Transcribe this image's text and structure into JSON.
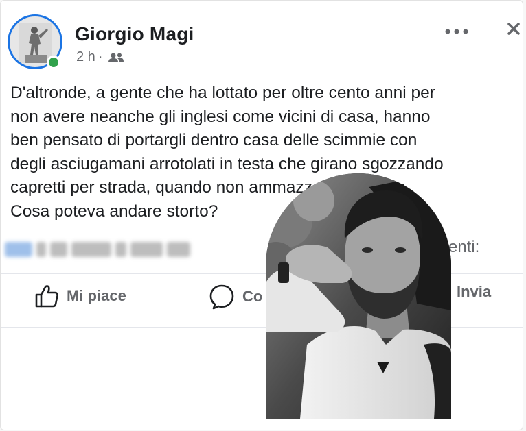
{
  "post": {
    "author_name": "Giorgio Magi",
    "timestamp": "2 h",
    "separator": "·",
    "text": "D'altronde, a gente che ha lottato per oltre cento anni per\nnon avere neanche gli inglesi come vicini di casa, hanno\nben pensato di portargli dentro casa delle scimmie con\ndegli asciugamani arrotolati in testa che girano sgozzando\ncapretti per strada, quando non ammazzano persone.\nCosa poteva andare storto?",
    "comments_label": "mmenti:"
  },
  "actions": {
    "like_label": "Mi piace",
    "comment_label": "Co",
    "send_label": "Invia"
  },
  "icons": {
    "audience": "friends-icon",
    "more": "more-options-icon",
    "close": "close-icon",
    "like": "thumbs-up-icon",
    "comment": "comment-bubble-icon"
  },
  "colors": {
    "online": "#31a24c",
    "avatar_ring": "#1b74e4",
    "text_primary": "#1c1e21",
    "text_secondary": "#65676b"
  }
}
